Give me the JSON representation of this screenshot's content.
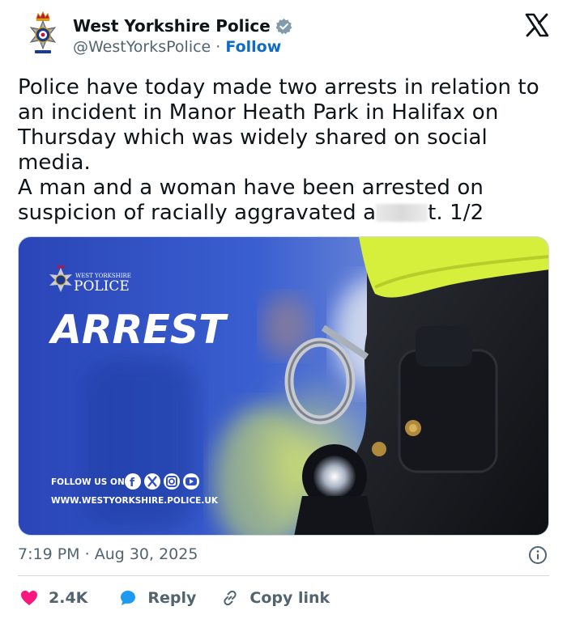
{
  "author": {
    "display_name": "West Yorkshire Police",
    "handle": "@WestYorksPolice",
    "separator": "·",
    "follow_label": "Follow"
  },
  "tweet": {
    "text_before_redaction": "Police have today made two arrests in relation to an incident in Manor Heath Park in Halifax on Thursday which was widely shared on social media.\nA man and a woman have been arrested on suspicion of racially aggravated a",
    "text_after_redaction": "t. 1/2"
  },
  "media": {
    "org_small": "WEST YORKSHIRE",
    "org_large": "POLICE",
    "headline": "ARREST",
    "follow_us": "FOLLOW US ON:",
    "website": "WWW.WESTYORKSHIRE.POLICE.UK"
  },
  "meta": {
    "time": "7:19 PM",
    "separator": "·",
    "date": "Aug 30, 2025"
  },
  "actions": {
    "likes": "2.4K",
    "reply_label": "Reply",
    "copy_label": "Copy link"
  },
  "colors": {
    "text": "#0f1419",
    "secondary": "#536471",
    "link": "#0f6bc4",
    "like": "#f91880",
    "reply": "#1d9bf0",
    "divider": "#cfd9de",
    "banner_blue": "#2f4fc4",
    "hi_vis": "#d8f23a"
  },
  "icons": {
    "verified": "verified-badge-icon",
    "x": "x-logo-icon",
    "info": "info-icon",
    "like": "heart-icon",
    "reply": "speech-bubble-icon",
    "copy": "link-icon"
  }
}
